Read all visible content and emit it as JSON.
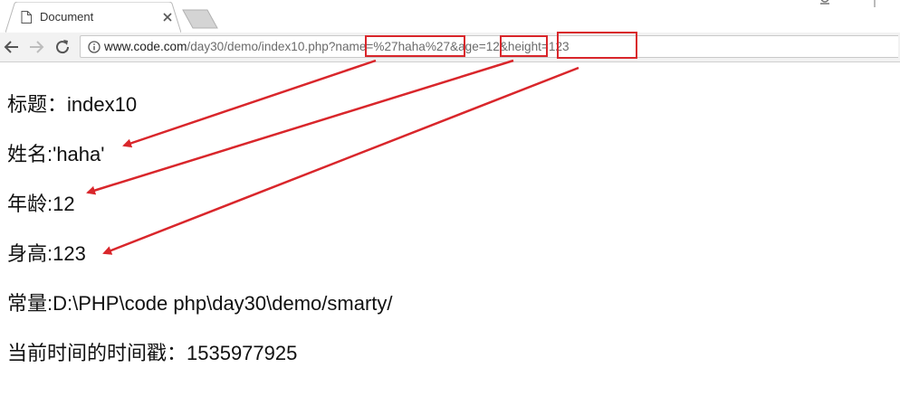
{
  "tab": {
    "title": "Document",
    "icon": "document-icon",
    "close_icon": "close-icon"
  },
  "toolbar": {
    "back_icon": "back-arrow-icon",
    "forward_icon": "forward-arrow-icon",
    "reload_icon": "reload-icon",
    "info_icon": "info-icon"
  },
  "address_bar": {
    "host": "www.code.com",
    "path": "/day30/demo/index10.php?name=%27haha%27&age=12&height=123"
  },
  "page": {
    "lines": [
      "标题：index10",
      "姓名:'haha'",
      "年龄:12",
      "身高:123",
      "常量:D:\\PHP\\code php\\day30\\demo/smarty/",
      "当前时间的时间戳：1535977925"
    ]
  },
  "annotation_color": "#d9262b"
}
